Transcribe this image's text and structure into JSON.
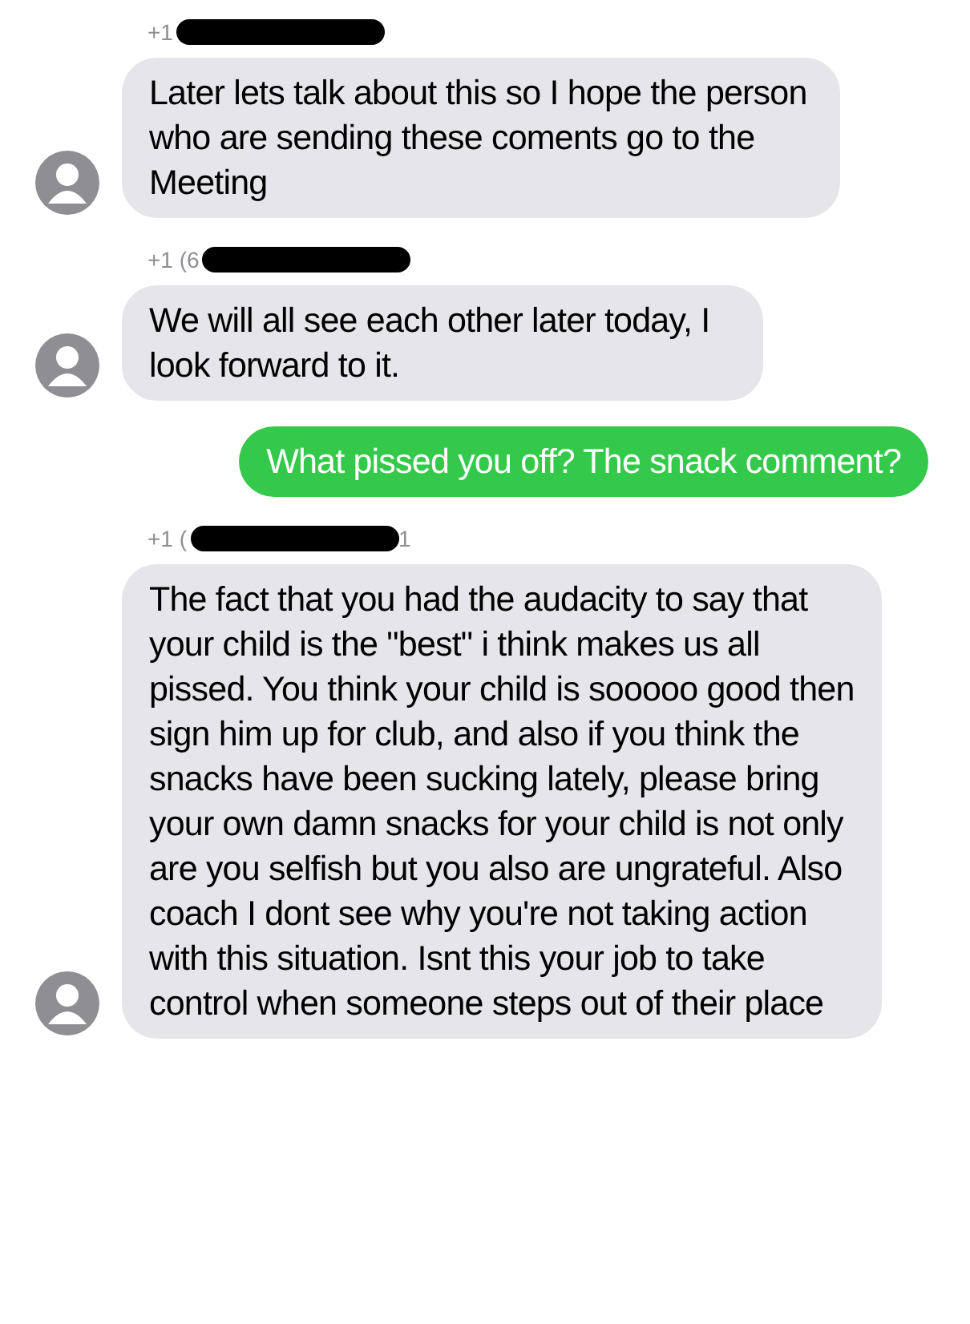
{
  "messages": [
    {
      "kind": "incoming",
      "sender": {
        "text": "+1"
      },
      "text": "Later lets talk about this so I hope the person who are sending these coments go to the Meeting"
    },
    {
      "kind": "incoming",
      "sender": {
        "text": "+1 (6"
      },
      "text": "We will all see each other later today, I look forward to it."
    },
    {
      "kind": "outgoing",
      "text": "What pissed you off? The snack comment?"
    },
    {
      "kind": "incoming",
      "sender": {
        "text": "+1 (",
        "suffix": "1"
      },
      "text": "The fact that you had the audacity to say that your child is the \"best\" i think makes us all pissed. You think your child is sooooo good then sign him up for club, and also if you think the snacks have been sucking lately, please bring your own damn snacks for your child is not only are you selfish but you also are ungrateful. Also coach I dont see why you're not taking action with this situation. Isnt this your job to take control when someone steps out of their place"
    }
  ]
}
